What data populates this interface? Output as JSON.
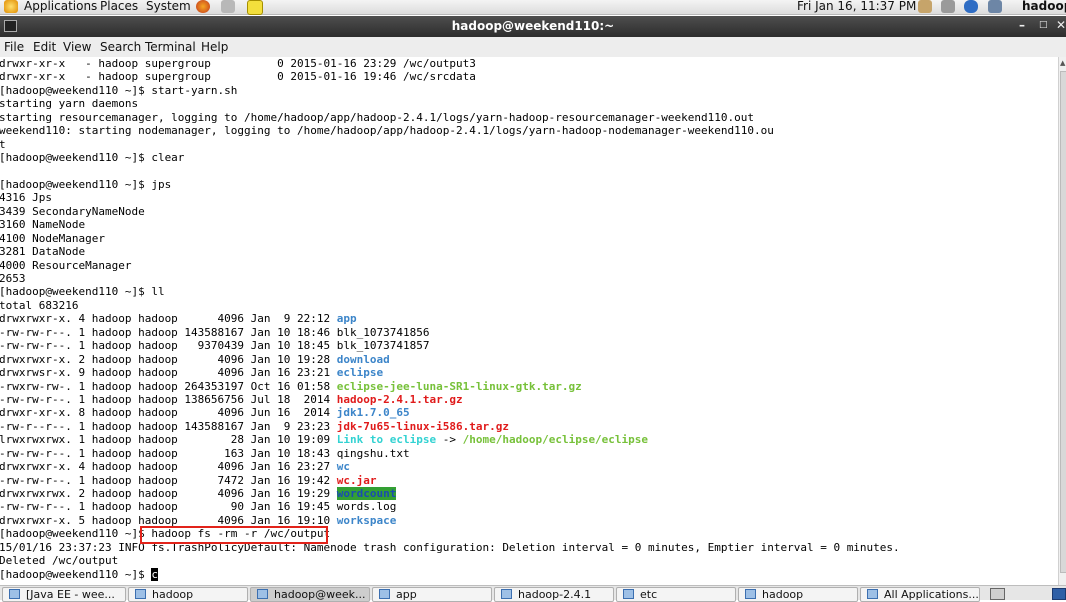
{
  "topbar": {
    "menus": [
      "Applications",
      "Places",
      "System"
    ],
    "clock": "Fri Jan 16, 11:37 PM",
    "user": "hadoop"
  },
  "window": {
    "title": "hadoop@weekend110:~",
    "menu": [
      "File",
      "Edit",
      "View",
      "Search",
      "Terminal",
      "Help"
    ]
  },
  "terminal": {
    "lines": [
      [
        {
          "t": "drwxr-xr-x   - hadoop supergroup          0 2015-01-16 23:29 /wc/output3"
        }
      ],
      [
        {
          "t": "drwxr-xr-x   - hadoop supergroup          0 2015-01-16 19:46 /wc/srcdata"
        }
      ],
      [
        {
          "t": "[hadoop@weekend110 ~]$ start-yarn.sh"
        }
      ],
      [
        {
          "t": "starting yarn daemons"
        }
      ],
      [
        {
          "t": "starting resourcemanager, logging to /home/hadoop/app/hadoop-2.4.1/logs/yarn-hadoop-resourcemanager-weekend110.out"
        }
      ],
      [
        {
          "t": "weekend110: starting nodemanager, logging to /home/hadoop/app/hadoop-2.4.1/logs/yarn-hadoop-nodemanager-weekend110.ou"
        }
      ],
      [
        {
          "t": "t"
        }
      ],
      [
        {
          "t": "[hadoop@weekend110 ~]$ clear"
        }
      ],
      [
        {
          "t": ""
        }
      ],
      [
        {
          "t": "[hadoop@weekend110 ~]$ jps"
        }
      ],
      [
        {
          "t": "4316 Jps"
        }
      ],
      [
        {
          "t": "3439 SecondaryNameNode"
        }
      ],
      [
        {
          "t": "3160 NameNode"
        }
      ],
      [
        {
          "t": "4100 NodeManager"
        }
      ],
      [
        {
          "t": "3281 DataNode"
        }
      ],
      [
        {
          "t": "4000 ResourceManager"
        }
      ],
      [
        {
          "t": "2653"
        }
      ],
      [
        {
          "t": "[hadoop@weekend110 ~]$ ll"
        }
      ],
      [
        {
          "t": "total 683216"
        }
      ],
      [
        {
          "t": "drwxrwxr-x. 4 hadoop hadoop      4096 Jan  9 22:12 "
        },
        {
          "t": "app",
          "c": "blue"
        }
      ],
      [
        {
          "t": "-rw-rw-r--. 1 hadoop hadoop 143588167 Jan 10 18:46 blk_1073741856"
        }
      ],
      [
        {
          "t": "-rw-rw-r--. 1 hadoop hadoop   9370439 Jan 10 18:45 blk_1073741857"
        }
      ],
      [
        {
          "t": "drwxrwxr-x. 2 hadoop hadoop      4096 Jan 10 19:28 "
        },
        {
          "t": "download",
          "c": "blue"
        }
      ],
      [
        {
          "t": "drwxrwsr-x. 9 hadoop hadoop      4096 Jan 16 23:21 "
        },
        {
          "t": "eclipse",
          "c": "blue"
        }
      ],
      [
        {
          "t": "-rwxrw-rw-. 1 hadoop hadoop 264353197 Oct 16 01:58 "
        },
        {
          "t": "eclipse-jee-luna-SR1-linux-gtk.tar.gz",
          "c": "green"
        }
      ],
      [
        {
          "t": "-rw-rw-r--. 1 hadoop hadoop 138656756 Jul 18  2014 "
        },
        {
          "t": "hadoop-2.4.1.tar.gz",
          "c": "red"
        }
      ],
      [
        {
          "t": "drwxr-xr-x. 8 hadoop hadoop      4096 Jun 16  2014 "
        },
        {
          "t": "jdk1.7.0_65",
          "c": "blue"
        }
      ],
      [
        {
          "t": "-rw-r--r--. 1 hadoop hadoop 143588167 Jan  9 23:23 "
        },
        {
          "t": "jdk-7u65-linux-i586.tar.gz",
          "c": "red"
        }
      ],
      [
        {
          "t": "lrwxrwxrwx. 1 hadoop hadoop        28 Jan 10 19:09 "
        },
        {
          "t": "Link to eclipse",
          "c": "cyan"
        },
        {
          "t": " -> "
        },
        {
          "t": "/home/hadoop/eclipse/eclipse",
          "c": "green"
        }
      ],
      [
        {
          "t": "-rw-rw-r--. 1 hadoop hadoop       163 Jan 10 18:43 qingshu.txt"
        }
      ],
      [
        {
          "t": "drwxrwxr-x. 4 hadoop hadoop      4096 Jan 16 23:27 "
        },
        {
          "t": "wc",
          "c": "blue"
        }
      ],
      [
        {
          "t": "-rw-rw-r--. 1 hadoop hadoop      7472 Jan 16 19:42 "
        },
        {
          "t": "wc.jar",
          "c": "red"
        }
      ],
      [
        {
          "t": "drwxrwxrwx. 2 hadoop hadoop      4096 Jan 16 19:29 "
        },
        {
          "t": "wordcount",
          "c": "hl"
        }
      ],
      [
        {
          "t": "-rw-rw-r--. 1 hadoop hadoop        90 Jan 16 19:45 words.log"
        }
      ],
      [
        {
          "t": "drwxrwxr-x. 5 hadoop hadoop      4096 Jan 16 19:10 "
        },
        {
          "t": "workspace",
          "c": "blue"
        }
      ],
      [
        {
          "t": "[hadoop@weekend110 ~]$ hadoop fs -rm -r /wc/output"
        }
      ],
      [
        {
          "t": "15/01/16 23:37:23 INFO fs.TrashPolicyDefault: Namenode trash configuration: Deletion interval = 0 minutes, Emptier interval = 0 minutes."
        }
      ],
      [
        {
          "t": "Deleted /wc/output"
        }
      ],
      [
        {
          "t": "[hadoop@weekend110 ~]$ "
        },
        {
          "t": "c",
          "c": "cursor"
        }
      ]
    ]
  },
  "taskbar": {
    "items": [
      {
        "label": "[Java EE - wee...",
        "icon": "eclipse-icon"
      },
      {
        "label": "hadoop",
        "icon": "folder-icon"
      },
      {
        "label": "hadoop@week...",
        "icon": "terminal-icon",
        "active": true
      },
      {
        "label": "app",
        "icon": "folder-icon"
      },
      {
        "label": "hadoop-2.4.1",
        "icon": "folder-icon"
      },
      {
        "label": "etc",
        "icon": "folder-icon"
      },
      {
        "label": "hadoop",
        "icon": "folder-icon"
      },
      {
        "label": "All Applications...",
        "icon": "firefox-icon"
      }
    ]
  }
}
